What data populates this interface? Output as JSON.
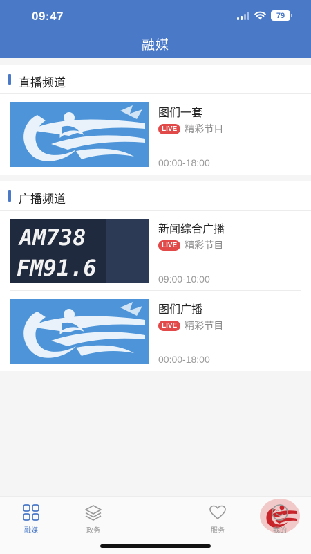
{
  "status_bar": {
    "time": "09:47",
    "battery": "79"
  },
  "header": {
    "title": "融媒"
  },
  "sections": [
    {
      "title": "直播频道",
      "items": [
        {
          "title": "图们一套",
          "badge": "LIVE",
          "subtitle": "精彩节目",
          "time": "00:00-18:00",
          "thumb": "logo"
        }
      ]
    },
    {
      "title": "广播频道",
      "items": [
        {
          "title": "新闻综合广播",
          "badge": "LIVE",
          "subtitle": "精彩节目",
          "time": "09:00-10:00",
          "thumb": "am-fm",
          "thumb_text": [
            "AM738",
            "FM91.6"
          ]
        },
        {
          "title": "图们广播",
          "badge": "LIVE",
          "subtitle": "精彩节目",
          "time": "00:00-18:00",
          "thumb": "logo"
        }
      ]
    }
  ],
  "tabbar": {
    "items": [
      {
        "label": "融媒",
        "icon": "grid-icon",
        "active": true
      },
      {
        "label": "政务",
        "icon": "layers-icon",
        "active": false
      },
      {
        "label": "",
        "icon": "center-logo-icon",
        "active": false
      },
      {
        "label": "服务",
        "icon": "heart-icon",
        "active": false
      },
      {
        "label": "我的",
        "icon": "smiley-icon",
        "active": false
      }
    ]
  },
  "colors": {
    "brand": "#4a79c8",
    "live": "#e24a4a",
    "logo_bg": "#4d95d8"
  }
}
